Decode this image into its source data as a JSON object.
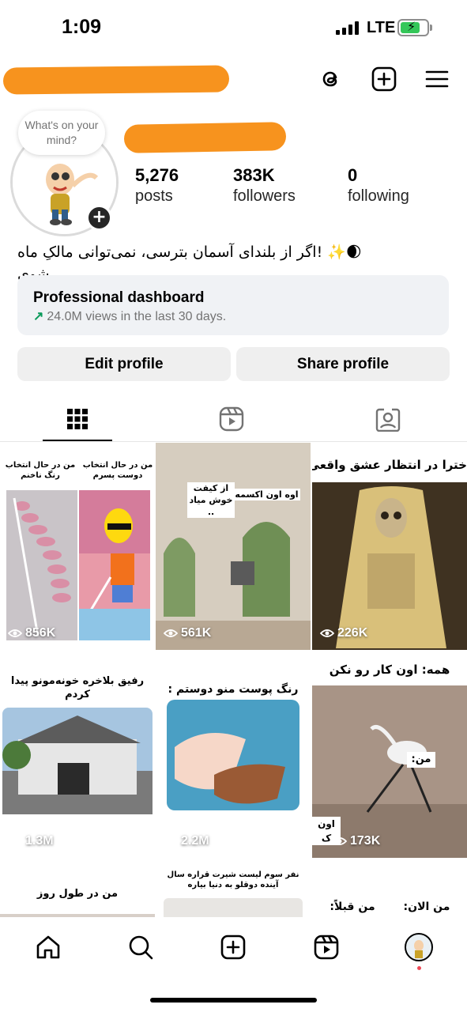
{
  "status_bar": {
    "time": "1:09",
    "network": "LTE"
  },
  "profile": {
    "note": "What's on your mind?",
    "stats": {
      "posts_count": "5,276",
      "posts_label": "posts",
      "followers_count": "383K",
      "followers_label": "followers",
      "following_count": "0",
      "following_label": "following"
    },
    "bio": "🌒✨ !اگر از بلندای آسمان بترسی، نمی‌توانی مالکِ ماه شوی"
  },
  "dashboard": {
    "title": "Professional dashboard",
    "subtitle": "24.0M views in the last 30 days."
  },
  "actions": {
    "edit_label": "Edit profile",
    "share_label": "Share profile"
  },
  "posts": [
    {
      "views": "856K",
      "caption_left": "من در حال انتخاب رنگ ناخنم",
      "caption_right": "من در حال انتخاب دوست پسرم"
    },
    {
      "views": "561K",
      "caption_left": "از کیفت خوش میاد ..",
      "caption_right": "اوه اون اکسمه"
    },
    {
      "views": "226K",
      "caption": "خترا در انتظار عشق واقعی"
    },
    {
      "views": "1.3M",
      "caption": "رفیق بلاخره خونه‌مونو پیدا کردم"
    },
    {
      "views": "2.2M",
      "caption": "رنگ پوست منو دوستم :"
    },
    {
      "views": "173K",
      "caption": "همه: اون کار رو نکن",
      "label": "من:",
      "label_cut": "اون ک"
    },
    {
      "caption": "من در طول روز"
    },
    {
      "caption": "نفر سوم لیست شیرت قراره سال آینده دوقلو به دنیا بیاره"
    },
    {
      "caption_left": "من قبلاً:",
      "caption_right": "من الان:"
    }
  ],
  "colors": {
    "accent_green": "#0a9a5a",
    "redaction": "#f7931e",
    "notification_dot": "#ed4956"
  }
}
